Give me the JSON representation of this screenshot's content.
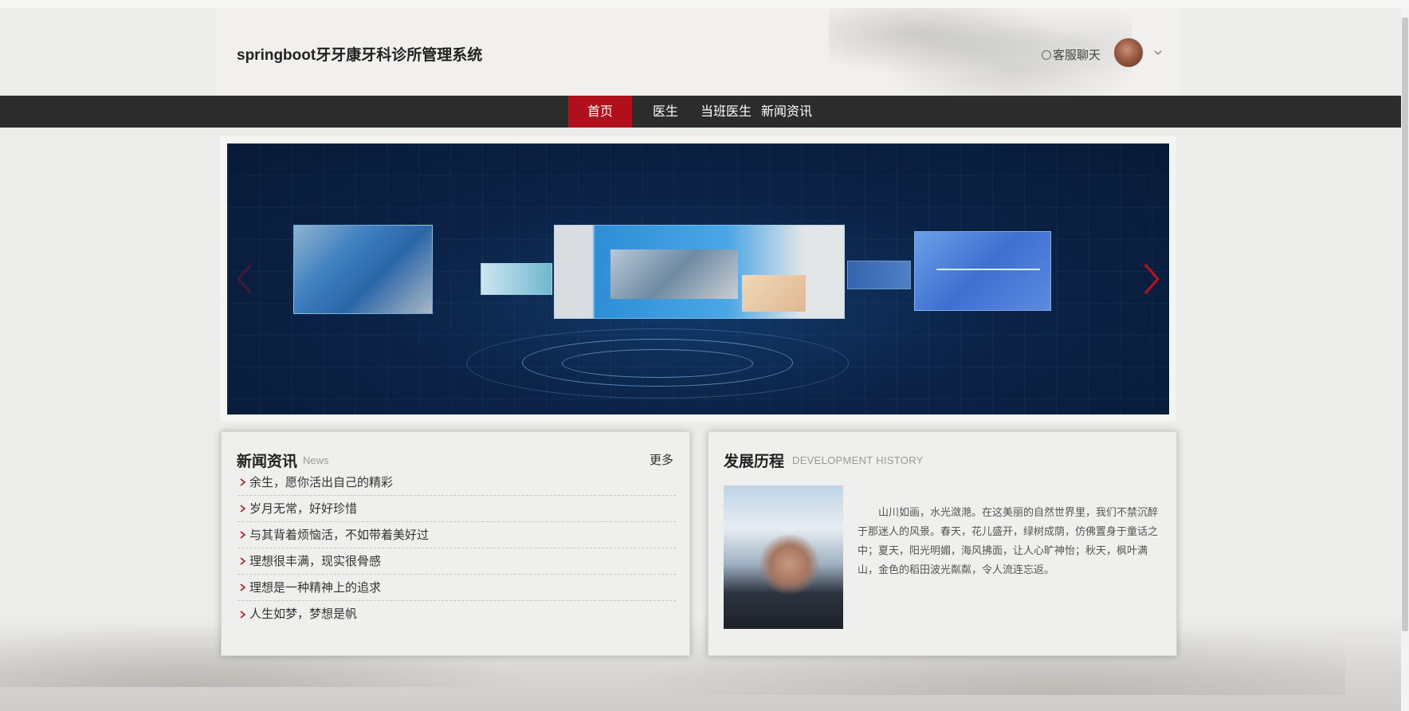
{
  "header": {
    "site_title": "springboot牙牙康牙科诊所管理系统",
    "chat_label": "客服聊天"
  },
  "nav": {
    "items": [
      {
        "label": "首页",
        "active": true
      },
      {
        "label": "医生",
        "active": false
      },
      {
        "label": "当班医生",
        "active": false
      },
      {
        "label": "新闻资讯",
        "active": false
      }
    ]
  },
  "banner": {
    "prev_icon": "chevron-left-icon",
    "next_icon": "chevron-right-icon"
  },
  "news": {
    "title": "新闻资讯",
    "subtitle": "News",
    "more_label": "更多",
    "items": [
      "余生，愿你活出自己的精彩",
      "岁月无常，好好珍惜",
      "与其背着烦恼活，不如带着美好过",
      "理想很丰满，现实很骨感",
      "理想是一种精神上的追求",
      "人生如梦，梦想是帆"
    ]
  },
  "history": {
    "title": "发展历程",
    "subtitle": "DEVELOPMENT HISTORY",
    "text": "山川如画，水光潋滟。在这美丽的自然世界里，我们不禁沉醉于那迷人的风景。春天，花儿盛开，绿树成荫，仿佛置身于童话之中；夏天，阳光明媚，海风拂面，让人心旷神怡；秋天，枫叶满山，金色的稻田波光粼粼，令人流连忘返。"
  },
  "colors": {
    "accent": "#b00f1b",
    "nav_bg": "#2c2c2c",
    "page_bg": "#ececea"
  }
}
